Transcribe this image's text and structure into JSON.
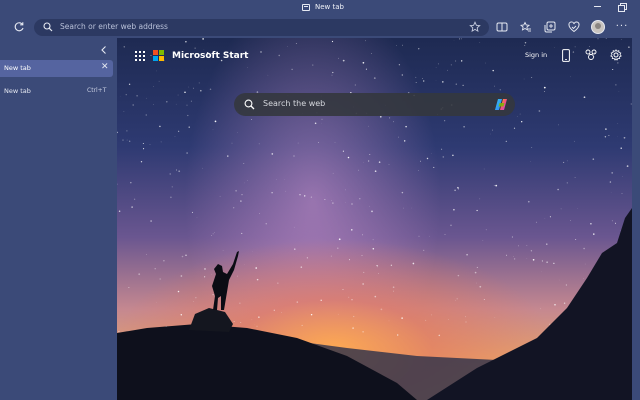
{
  "window": {
    "title": "New tab"
  },
  "toolbar": {
    "address_placeholder": "Search or enter web address"
  },
  "sidebar": {
    "active_tab": {
      "label": "New tab",
      "close_glyph": "✕"
    },
    "new_tab_item": {
      "label": "New tab",
      "shortcut": "Ctrl+T"
    }
  },
  "page": {
    "brand": "Microsoft Start",
    "sign_in": "Sign in",
    "search_placeholder": "Search the web"
  },
  "colors": {
    "chrome": "#3b4a78",
    "active_tab": "#5564a0",
    "ms_red": "#f25022",
    "ms_green": "#7fba00",
    "ms_blue": "#00a4ef",
    "ms_yellow": "#ffb900"
  },
  "icons": [
    "tab-icon",
    "minimize-icon",
    "restore-icon",
    "refresh-icon",
    "search-icon",
    "favorite-star-icon",
    "split-screen-icon",
    "favorites-icon",
    "collections-icon",
    "browser-essentials-icon",
    "profile-avatar",
    "more-icon",
    "collapse-chevron-icon",
    "apps-grid-icon",
    "microsoft-logo-icon",
    "phone-icon",
    "rewards-icon",
    "settings-gear-icon",
    "copilot-icon"
  ]
}
